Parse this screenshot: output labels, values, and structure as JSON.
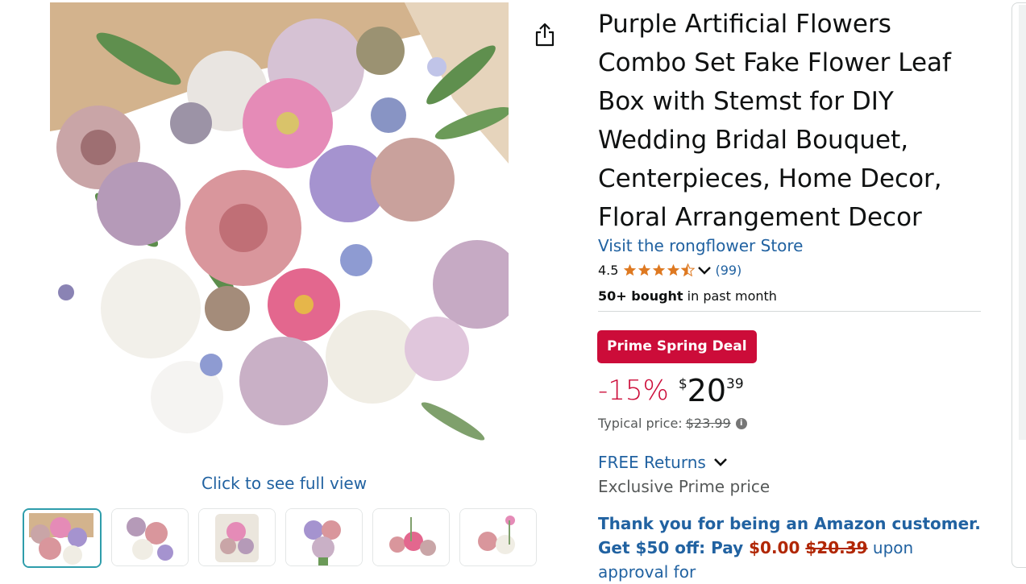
{
  "product": {
    "title": "Purple Artificial Flowers Combo Set Fake Flower Leaf Box with Stemst for DIY Wedding Bridal Bouquet, Centerpieces, Home Decor, Floral Arrangement Decor",
    "store_link": "Visit the rongflower Store",
    "rating_value": "4.5",
    "rating_stars": 4.5,
    "rating_count": "(99)",
    "bought_bold": "50+ bought",
    "bought_rest": " in past month"
  },
  "gallery": {
    "full_view_label": "Click to see full view",
    "thumbnail_count": 6,
    "active_thumbnail": 1
  },
  "deal": {
    "badge": "Prime Spring Deal",
    "discount": "-15%",
    "price_symbol": "$",
    "price_whole": "20",
    "price_fraction": "39",
    "typical_label": "Typical price:",
    "typical_price": "$23.99"
  },
  "returns": {
    "label": "FREE Returns",
    "exclusive": "Exclusive Prime price"
  },
  "promo": {
    "line_a": "Thank you for being an Amazon customer. Get $50 off: Pay ",
    "pay_amount": "$0.00",
    "old_amount": "$20.39",
    "line_b": " upon approval for"
  },
  "colors": {
    "link": "#2162a1",
    "deal_red": "#cc0c39",
    "star": "#de7921",
    "thumb_active": "#2e9dab"
  },
  "icons": {
    "share": "share-icon",
    "info": "info-icon",
    "chevron": "chevron-down-icon",
    "star": "star-icon"
  }
}
